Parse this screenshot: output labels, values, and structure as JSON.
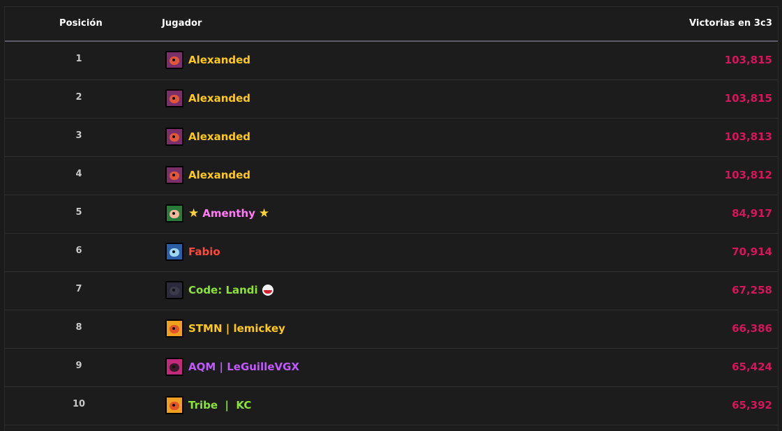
{
  "table": {
    "headers": {
      "position": "Posición",
      "player": "Jugador",
      "wins": "Victorias en 3c3"
    },
    "rows": [
      {
        "rank": "1",
        "name": "Alexanded",
        "wins": "103,815",
        "name_color": "#ffc81c",
        "avatar": "brawler-avatar-icon",
        "avatar_bg": "#7a2f6a",
        "avatar_face": "#e0573a"
      },
      {
        "rank": "2",
        "name": "Alexanded",
        "wins": "103,815",
        "name_color": "#ffc81c",
        "avatar": "brawler-avatar-icon",
        "avatar_bg": "#7a2f6a",
        "avatar_face": "#e0573a"
      },
      {
        "rank": "3",
        "name": "Alexanded",
        "wins": "103,813",
        "name_color": "#ffc81c",
        "avatar": "brawler-avatar-icon",
        "avatar_bg": "#7a2f6a",
        "avatar_face": "#e0573a"
      },
      {
        "rank": "4",
        "name": "Alexanded",
        "wins": "103,812",
        "name_color": "#ffc81c",
        "avatar": "brawler-avatar-icon",
        "avatar_bg": "#7a2f6a",
        "avatar_face": "#e0573a"
      },
      {
        "rank": "5",
        "name": "Amenthy",
        "wins": "84,917",
        "name_color": "#ff7cf6",
        "avatar": "brawler-avatar-icon",
        "avatar_bg": "#2a7a3a",
        "avatar_face": "#f0b79a",
        "stars": true
      },
      {
        "rank": "6",
        "name": "Fabio",
        "wins": "70,914",
        "name_color": "#ff4a3a",
        "avatar": "brawler-avatar-icon",
        "avatar_bg": "#2a5fa8",
        "avatar_face": "#9fd6f0"
      },
      {
        "rank": "7",
        "name": "Code: Landi",
        "wins": "67,258",
        "name_color": "#8ee03a",
        "avatar": "brawler-avatar-icon",
        "avatar_bg": "#2a2a3a",
        "avatar_face": "#3a3a4a",
        "flag": true
      },
      {
        "rank": "8",
        "name": "STMN | lemickey",
        "wins": "66,386",
        "name_color": "#ffc81c",
        "avatar": "club-emblem-icon",
        "avatar_bg": "#f0a020",
        "avatar_face": "#e2552a"
      },
      {
        "rank": "9",
        "name": "AQM | LeGuilleVGX",
        "wins": "65,424",
        "name_color": "#c05aff",
        "avatar": "brawler-avatar-icon",
        "avatar_bg": "#c02a7a",
        "avatar_face": "#3a1a2a"
      },
      {
        "rank": "10",
        "name": "Tribe  |  KC",
        "wins": "65,392",
        "name_color": "#8ee03a",
        "avatar": "club-emblem-icon",
        "avatar_bg": "#f0a020",
        "avatar_face": "#e2552a"
      }
    ]
  }
}
